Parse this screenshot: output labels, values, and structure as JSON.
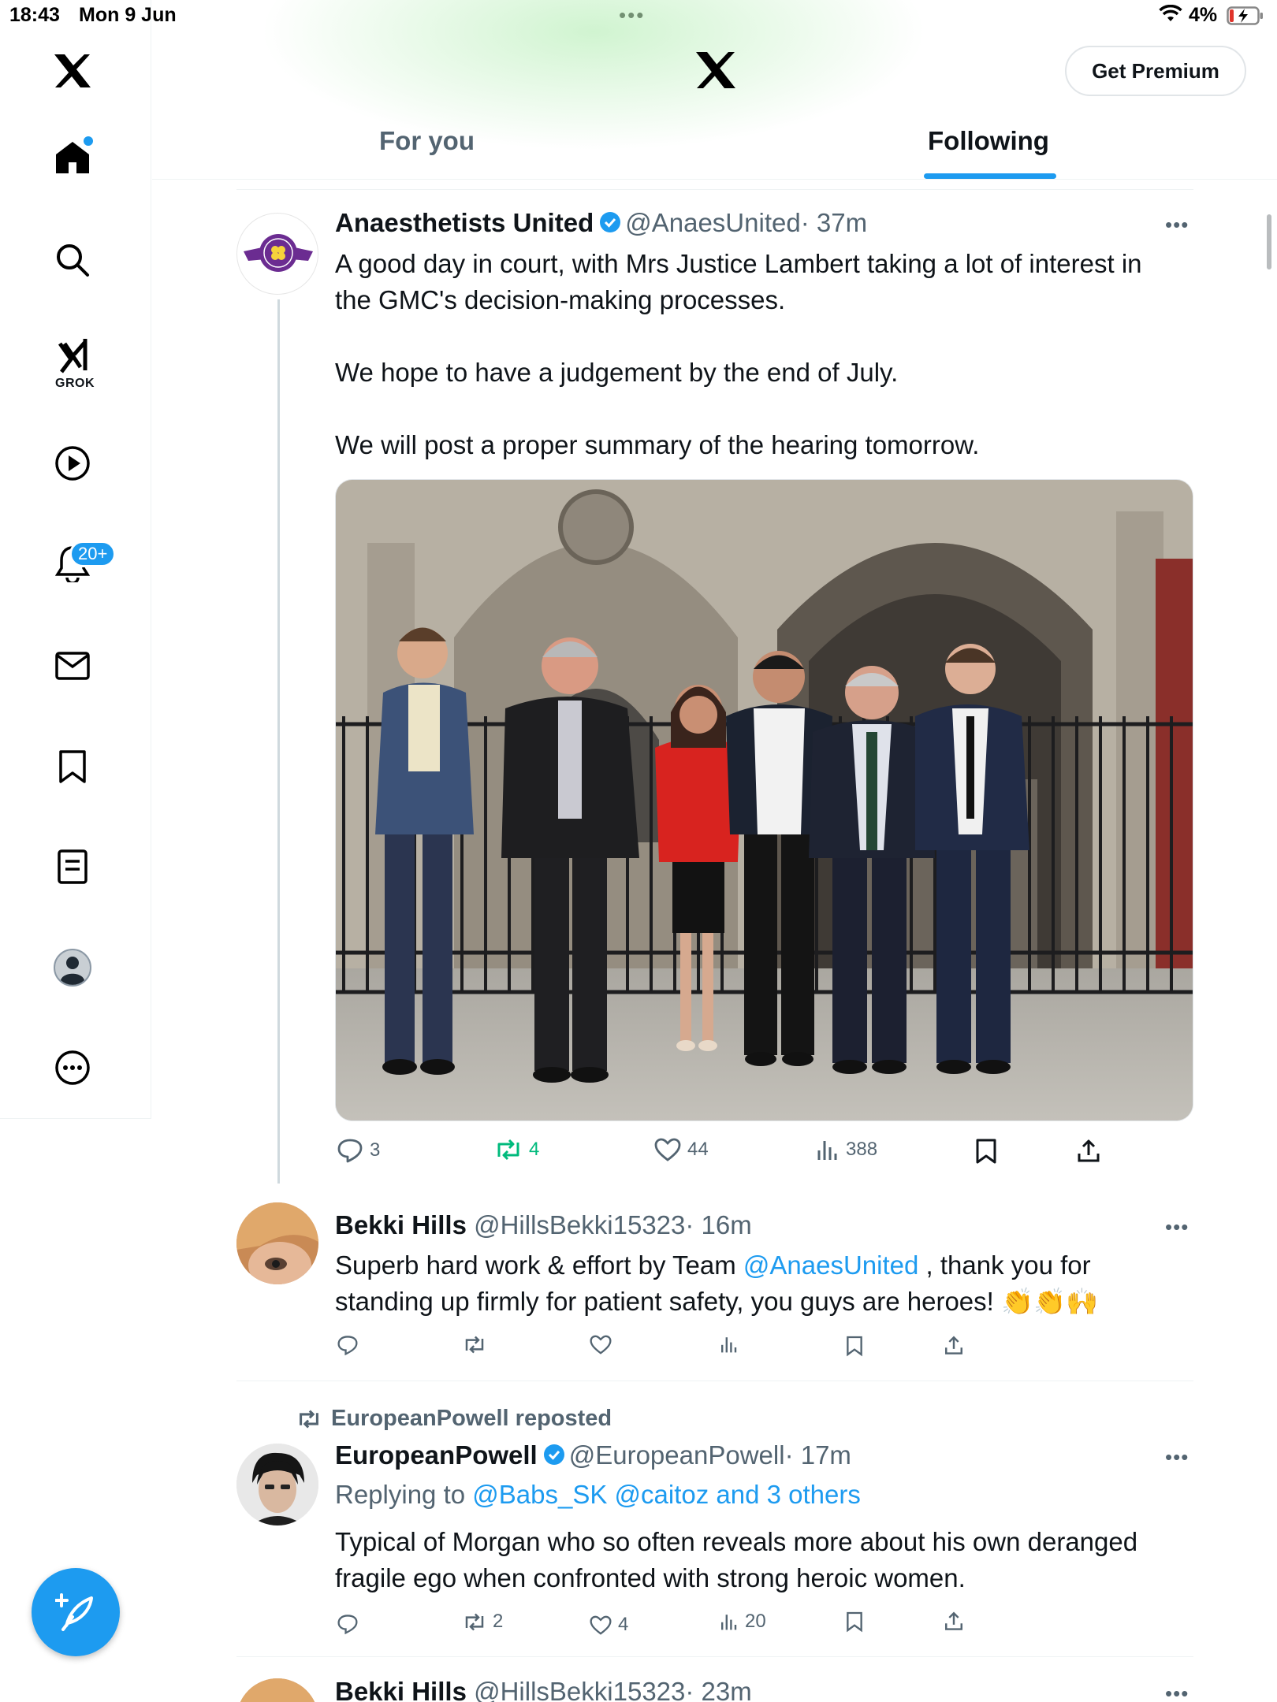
{
  "status_bar": {
    "time": "18:43",
    "date": "Mon 9 Jun",
    "battery": "4%"
  },
  "header": {
    "premium_label": "Get Premium",
    "tabs": [
      "For you",
      "Following"
    ],
    "active_tab": "Following"
  },
  "sidebar": {
    "grok_label": "GROK",
    "notifications_badge": "20+"
  },
  "colors": {
    "accent": "#1d9bf0",
    "repost_active": "#00ba7c",
    "secondary_text": "#536471"
  },
  "tweets": [
    {
      "name": "Anaesthetists United",
      "handle": "@AnaesUnited",
      "time": "· 37m",
      "verified": true,
      "text": "A good day in court, with Mrs Justice Lambert taking a lot of interest in\nthe GMC's decision-making processes.\n\nWe hope to have a judgement by the end of July.\n\nWe will post a proper summary of the hearing tomorrow.",
      "image_alt": "Six people standing in front of the Royal Courts of Justice gates",
      "replies": "3",
      "reposts": "4",
      "likes": "44",
      "views": "388"
    },
    {
      "name": "Bekki Hills",
      "handle": "@HillsBekki15323",
      "time": "· 16m",
      "text_before": "Superb hard work & effort by Team ",
      "mention": "@AnaesUnited",
      "text_after": " , thank you for\nstanding up firmly for patient safety, you guys are heroes! 👏👏🙌"
    },
    {
      "repost_label": "EuropeanPowell reposted",
      "name": "EuropeanPowell",
      "handle": "@EuropeanPowell",
      "time": "· 17m",
      "verified": true,
      "replying_label": "Replying to",
      "replying_to": "@Babs_SK @caitoz and 3 others",
      "text": "Typical of Morgan who so often reveals more about his own deranged\nfragile ego when confronted with strong heroic women.",
      "reposts": "2",
      "likes": "4",
      "views": "20"
    },
    {
      "name": "Bekki Hills",
      "handle": "@HillsBekki15323",
      "time": "· 23m"
    }
  ]
}
